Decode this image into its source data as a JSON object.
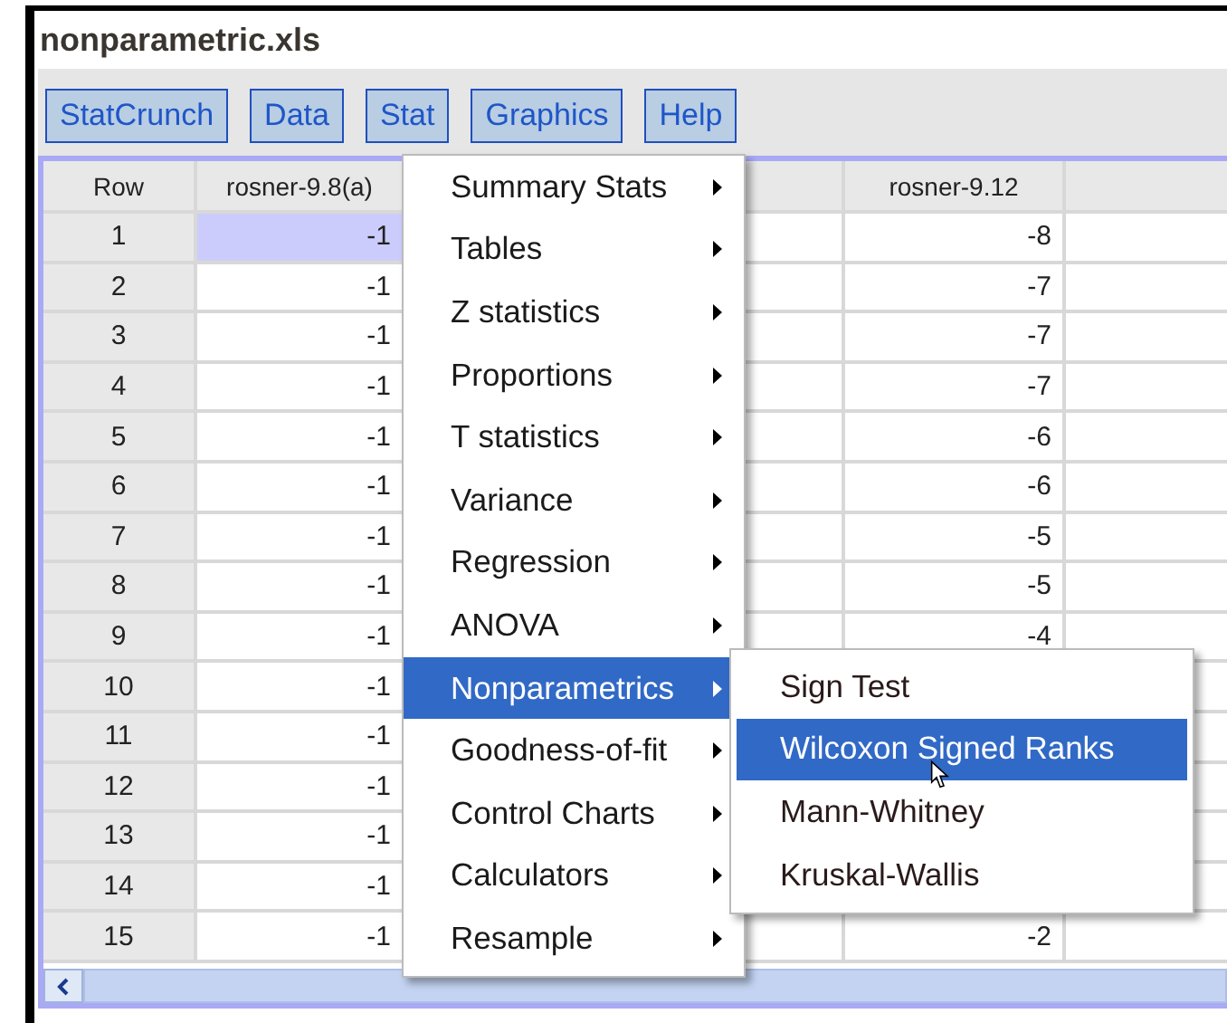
{
  "window": {
    "title": "nonparametric.xls"
  },
  "menubar": [
    {
      "label": "StatCrunch"
    },
    {
      "label": "Data"
    },
    {
      "label": "Stat"
    },
    {
      "label": "Graphics"
    },
    {
      "label": "Help"
    }
  ],
  "table": {
    "columns": [
      {
        "label": "Row"
      },
      {
        "label": "rosner-9.8(a)"
      },
      {
        "label": "rosner-9.12"
      }
    ],
    "rows": [
      {
        "row": "1",
        "col_2": "-1",
        "col_4": "-8",
        "selected": true
      },
      {
        "row": "2",
        "col_2": "-1",
        "col_4": "-7",
        "selected": false
      },
      {
        "row": "3",
        "col_2": "-1",
        "col_4": "-7",
        "selected": false
      },
      {
        "row": "4",
        "col_2": "-1",
        "col_4": "-7",
        "selected": false
      },
      {
        "row": "5",
        "col_2": "-1",
        "col_4": "-6",
        "selected": false
      },
      {
        "row": "6",
        "col_2": "-1",
        "col_4": "-6",
        "selected": false
      },
      {
        "row": "7",
        "col_2": "-1",
        "col_4": "-5",
        "selected": false
      },
      {
        "row": "8",
        "col_2": "-1",
        "col_4": "-5",
        "selected": false
      },
      {
        "row": "9",
        "col_2": "-1",
        "col_4": "-4",
        "selected": false
      },
      {
        "row": "10",
        "col_2": "-1",
        "selected": false
      },
      {
        "row": "11",
        "col_2": "-1",
        "selected": false
      },
      {
        "row": "12",
        "col_2": "-1",
        "selected": false
      },
      {
        "row": "13",
        "col_2": "-1",
        "selected": false
      },
      {
        "row": "14",
        "col_2": "-1",
        "selected": false
      },
      {
        "row": "15",
        "col_2": "-1",
        "col_4": "-2",
        "selected": false
      }
    ]
  },
  "stat_menu": {
    "items": [
      {
        "label": "Summary Stats",
        "submenu": true,
        "selected": false
      },
      {
        "label": "Tables",
        "submenu": true,
        "selected": false
      },
      {
        "label": "Z statistics",
        "submenu": true,
        "selected": false
      },
      {
        "label": "Proportions",
        "submenu": true,
        "selected": false
      },
      {
        "label": "T statistics",
        "submenu": true,
        "selected": false
      },
      {
        "label": "Variance",
        "submenu": true,
        "selected": false
      },
      {
        "label": "Regression",
        "submenu": true,
        "selected": false
      },
      {
        "label": "ANOVA",
        "submenu": true,
        "selected": false
      },
      {
        "label": "Nonparametrics",
        "submenu": true,
        "selected": true
      },
      {
        "label": "Goodness-of-fit",
        "submenu": true,
        "selected": false
      },
      {
        "label": "Control Charts",
        "submenu": true,
        "selected": false
      },
      {
        "label": "Calculators",
        "submenu": true,
        "selected": false
      },
      {
        "label": "Resample",
        "submenu": true,
        "selected": false
      }
    ]
  },
  "submenu": {
    "items": [
      {
        "label": "Sign Test",
        "selected": false
      },
      {
        "label": "Wilcoxon Signed Ranks",
        "selected": true
      },
      {
        "label": "Mann-Whitney",
        "selected": false
      },
      {
        "label": "Kruskal-Wallis",
        "selected": false
      }
    ]
  }
}
